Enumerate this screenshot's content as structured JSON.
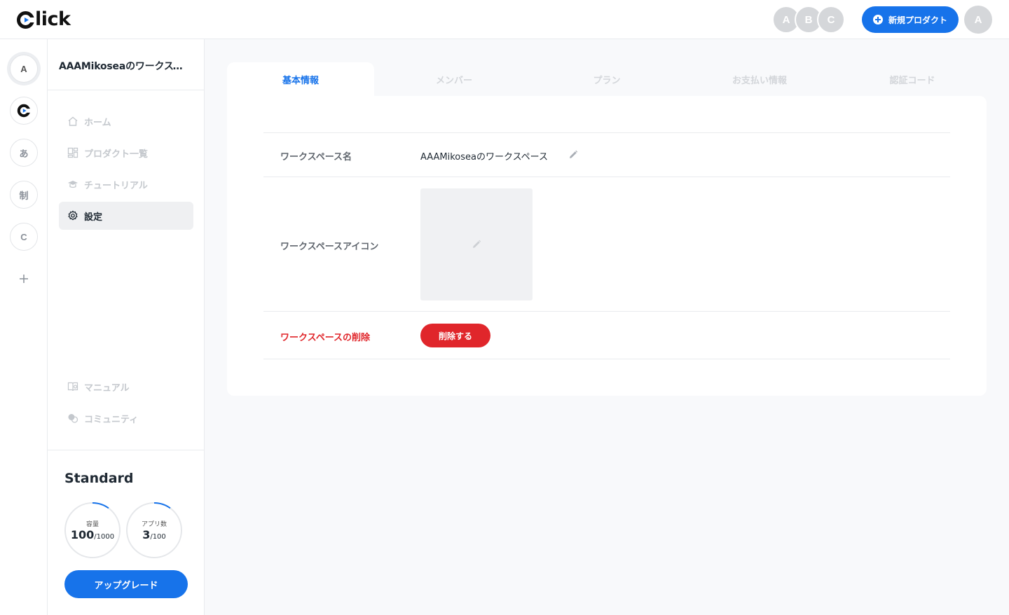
{
  "header": {
    "logo_text": "lick",
    "member_avatars": [
      "A",
      "B",
      "C"
    ],
    "new_product_label": "新規プロダクト",
    "user_avatar": "A"
  },
  "workspaces": {
    "items": [
      "A",
      "あ",
      "制",
      "C"
    ],
    "add_icon": "plus-icon"
  },
  "sidebar": {
    "workspace_title": "AAAMikoseaのワークスペース",
    "nav": [
      {
        "label": "ホーム",
        "icon": "home-icon"
      },
      {
        "label": "プロダクト一覧",
        "icon": "grid-icon"
      },
      {
        "label": "チュートリアル",
        "icon": "graduation-cap-icon"
      },
      {
        "label": "設定",
        "icon": "gear-icon"
      }
    ],
    "footer_nav": [
      {
        "label": "マニュアル",
        "icon": "book-icon"
      },
      {
        "label": "コミュニティ",
        "icon": "chat-icon"
      }
    ],
    "plan": {
      "name": "Standard",
      "capacity": {
        "label": "容量",
        "value": "100",
        "max": "/1000",
        "fraction": 0.1
      },
      "apps": {
        "label": "アプリ数",
        "value": "3",
        "max": "/100",
        "fraction": 0.03
      },
      "upgrade_label": "アップグレード"
    }
  },
  "tabs": [
    {
      "label": "基本情報",
      "active": true
    },
    {
      "label": "メンバー",
      "active": false
    },
    {
      "label": "プラン",
      "active": false
    },
    {
      "label": "お支払い情報",
      "active": false
    },
    {
      "label": "認証コード",
      "active": false
    }
  ],
  "settings": {
    "name_label": "ワークスペース名",
    "name_value": "AAAMikoseaのワークスペース",
    "icon_label": "ワークスペースアイコン",
    "delete_label": "ワークスペースの削除",
    "delete_button": "削除する"
  },
  "colors": {
    "accent": "#1773ea",
    "danger": "#e0262b",
    "muted": "#c4c8cd"
  }
}
